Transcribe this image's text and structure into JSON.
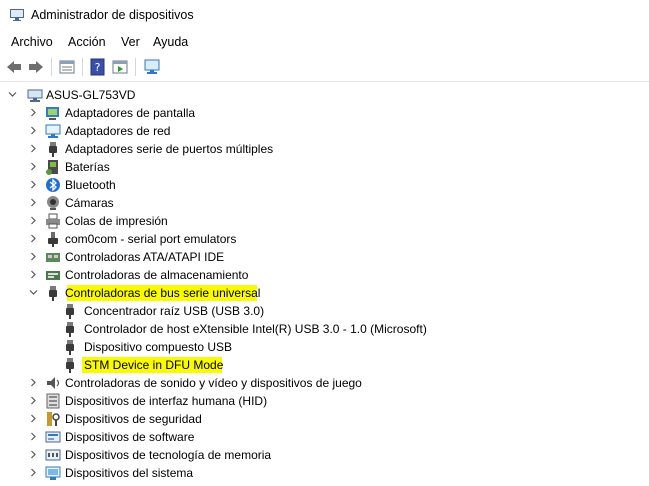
{
  "window": {
    "title": "Administrador de dispositivos"
  },
  "menu": {
    "items": [
      "Archivo",
      "Acción",
      "Ver",
      "Ayuda"
    ]
  },
  "toolbar": {
    "buttons": [
      "back-icon",
      "forward-icon",
      "properties-icon",
      "help-icon",
      "update-driver-icon",
      "scan-hardware-icon"
    ]
  },
  "tree": {
    "root": "ASUS-GL753VD",
    "categories": [
      {
        "label": "Adaptadores de pantalla",
        "icon": "display-adapter-icon"
      },
      {
        "label": "Adaptadores de red",
        "icon": "network-adapter-icon"
      },
      {
        "label": "Adaptadores serie de puertos múltiples",
        "icon": "usb-icon"
      },
      {
        "label": "Baterías",
        "icon": "battery-icon"
      },
      {
        "label": "Bluetooth",
        "icon": "bluetooth-icon"
      },
      {
        "label": "Cámaras",
        "icon": "camera-icon"
      },
      {
        "label": "Colas de impresión",
        "icon": "printer-icon"
      },
      {
        "label": "com0com - serial port emulators",
        "icon": "port-icon"
      },
      {
        "label": "Controladoras ATA/ATAPI IDE",
        "icon": "ide-controller-icon"
      },
      {
        "label": "Controladoras de almacenamiento",
        "icon": "storage-controller-icon"
      },
      {
        "label": "Controladoras de bus serie universal",
        "icon": "usb-icon",
        "expanded": true,
        "highlighted": true,
        "children": [
          {
            "label": "Concentrador raíz USB (USB 3.0)",
            "icon": "usb-icon"
          },
          {
            "label": "Controlador de host eXtensible Intel(R) USB 3.0 - 1.0 (Microsoft)",
            "icon": "usb-icon"
          },
          {
            "label": "Dispositivo compuesto USB",
            "icon": "usb-icon"
          },
          {
            "label": "STM Device in DFU Mode",
            "icon": "usb-icon",
            "highlighted": true
          }
        ]
      },
      {
        "label": "Controladoras de sonido y vídeo y dispositivos de juego",
        "icon": "sound-icon"
      },
      {
        "label": "Dispositivos de interfaz humana (HID)",
        "icon": "hid-icon"
      },
      {
        "label": "Dispositivos de seguridad",
        "icon": "security-device-icon"
      },
      {
        "label": "Dispositivos de software",
        "icon": "software-device-icon"
      },
      {
        "label": "Dispositivos de tecnología de memoria",
        "icon": "memory-device-icon"
      },
      {
        "label": "Dispositivos del sistema",
        "icon": "system-device-icon"
      }
    ]
  },
  "colors": {
    "highlight": "#fafa00",
    "chevron": "#555555"
  }
}
